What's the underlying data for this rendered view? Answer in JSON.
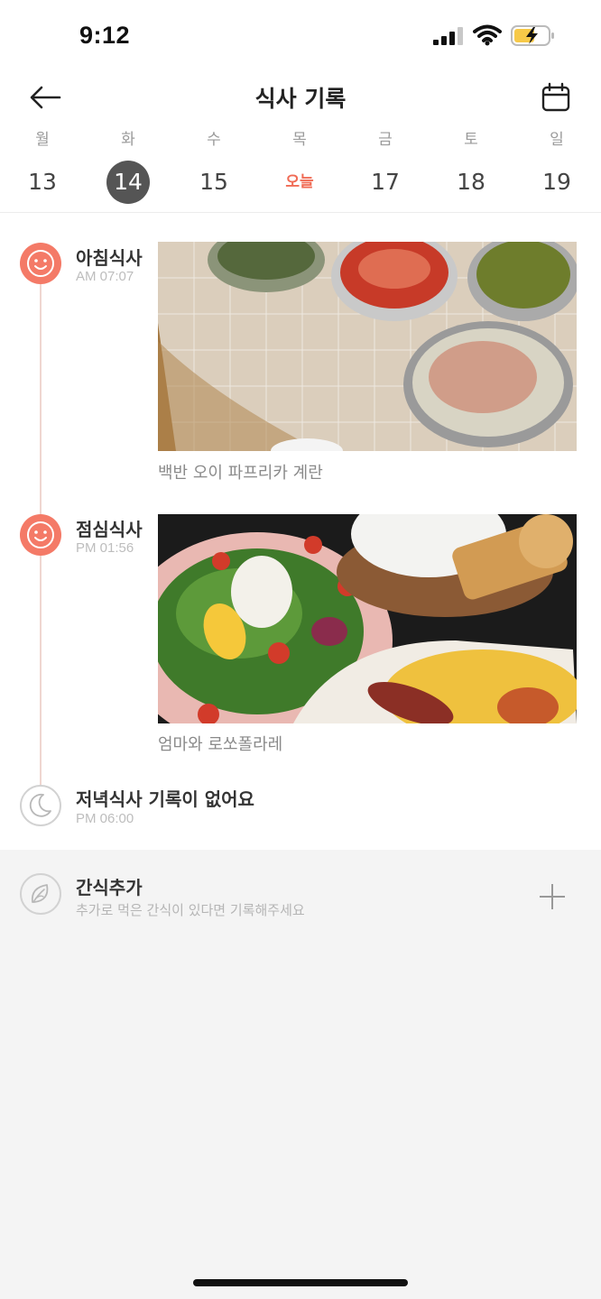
{
  "status_bar": {
    "time": "9:12"
  },
  "header": {
    "title": "식사 기록"
  },
  "week": {
    "days": [
      {
        "name": "월",
        "num": "13"
      },
      {
        "name": "화",
        "num": "14"
      },
      {
        "name": "수",
        "num": "15"
      },
      {
        "name": "목",
        "num": "오늘"
      },
      {
        "name": "금",
        "num": "17"
      },
      {
        "name": "토",
        "num": "18"
      },
      {
        "name": "일",
        "num": "19"
      }
    ]
  },
  "meals": {
    "breakfast": {
      "title": "아침식사",
      "time": "AM 07:07",
      "caption": "백반 오이 파프리카 계란"
    },
    "lunch": {
      "title": "점심식사",
      "time": "PM 01:56",
      "caption": "엄마와 로쏘폴라레"
    },
    "dinner": {
      "title": "저녁식사 기록이 없어요",
      "time": "PM 06:00"
    }
  },
  "snack": {
    "title": "간식추가",
    "subtitle": "추가로 먹은 간식이 있다면 기록해주세요"
  },
  "colors": {
    "accent": "#f47a67",
    "today_text": "#f06b55",
    "selected_day_bg": "#555555",
    "snack_bg": "#f4f4f4"
  }
}
